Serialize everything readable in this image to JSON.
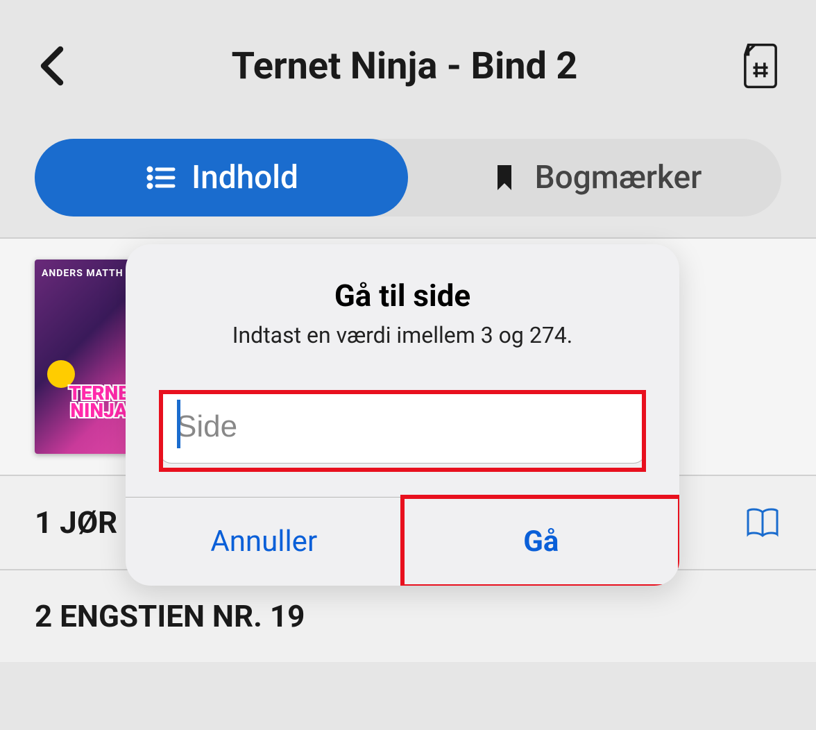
{
  "header": {
    "title": "Ternet Ninja - Bind 2"
  },
  "tabs": {
    "contents_label": "Indhold",
    "bookmarks_label": "Bogmærker"
  },
  "book": {
    "cover_author": "ANDERS MATTH",
    "cover_title_line1": "TERNE",
    "cover_title_line2": "NINJA"
  },
  "chapters": [
    {
      "label": "1 JØR"
    },
    {
      "label": "2 ENGSTIEN NR. 19"
    }
  ],
  "modal": {
    "title": "Gå til side",
    "subtitle": "Indtast en værdi imellem 3 og 274.",
    "placeholder": "Side",
    "cancel_label": "Annuller",
    "go_label": "Gå"
  }
}
